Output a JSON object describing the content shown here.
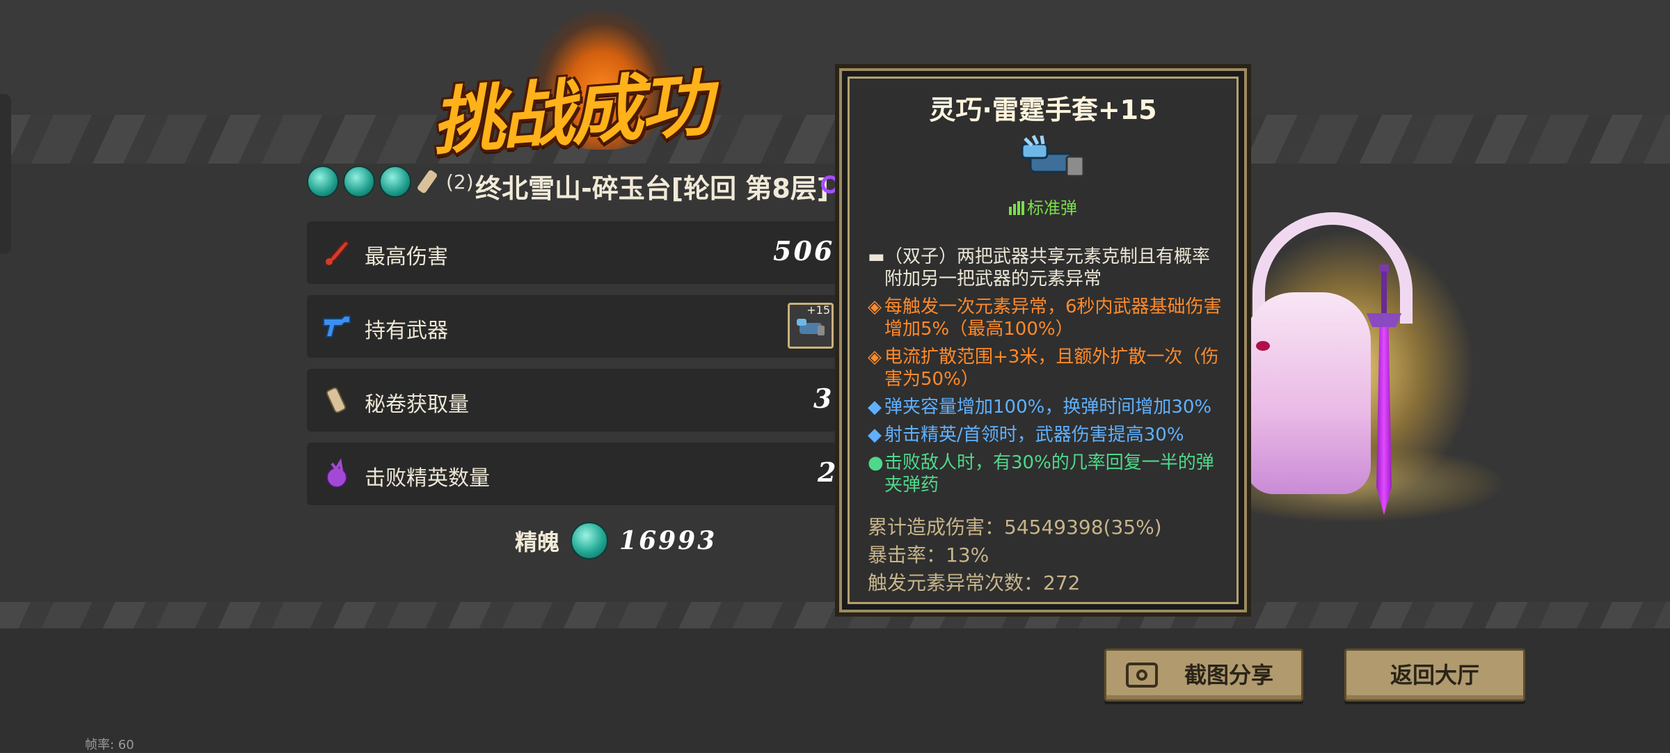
{
  "title": "挑战成功",
  "level": {
    "scroll_count": "(2)",
    "name": "终北雪山-碎玉台[轮回  第8层]"
  },
  "stats": [
    {
      "label": "最高伤害",
      "value": "506",
      "icon": "damage-icon"
    },
    {
      "label": "持有武器",
      "value": "",
      "weapon_plus": "+15",
      "icon": "weapon-icon"
    },
    {
      "label": "秘卷获取量",
      "value": "3",
      "icon": "scroll-icon"
    },
    {
      "label": "击败精英数量",
      "value": "2",
      "icon": "elite-icon"
    }
  ],
  "soul": {
    "label": "精魄",
    "value": "16993"
  },
  "tooltip": {
    "title": "灵巧·雷霆手套+15",
    "ammo_type": "标准弹",
    "lines": [
      {
        "marker": "▬",
        "color": "white",
        "text": "（双子）两把武器共享元素克制且有概率附加另一把武器的元素异常"
      },
      {
        "marker": "◈",
        "color": "orange",
        "text": "每触发一次元素异常，6秒内武器基础伤害增加5%（最高100%）"
      },
      {
        "marker": "◈",
        "color": "orange",
        "text": "电流扩散范围+3米，且额外扩散一次（伤害为50%）"
      },
      {
        "marker": "◆",
        "color": "blue",
        "text": "弹夹容量增加100%，换弹时间增加30%"
      },
      {
        "marker": "◆",
        "color": "blue",
        "text": "射击精英/首领时，武器伤害提高30%"
      },
      {
        "marker": "●",
        "color": "green",
        "text": "击败敌人时，有30%的几率回复一半的弹夹弹药"
      }
    ],
    "stats": [
      "累计造成伤害：54549398(35%)",
      "暴击率：13%",
      "触发元素异常次数：272"
    ]
  },
  "buttons": {
    "share": "截图分享",
    "back": "返回大厅"
  },
  "fps": "帧率: 60",
  "colors": {
    "accent": "#ffb21a",
    "orange": "#ff8a2a",
    "blue": "#5fb1ff",
    "green": "#4fd88a",
    "ammo": "#7bdd4a"
  }
}
